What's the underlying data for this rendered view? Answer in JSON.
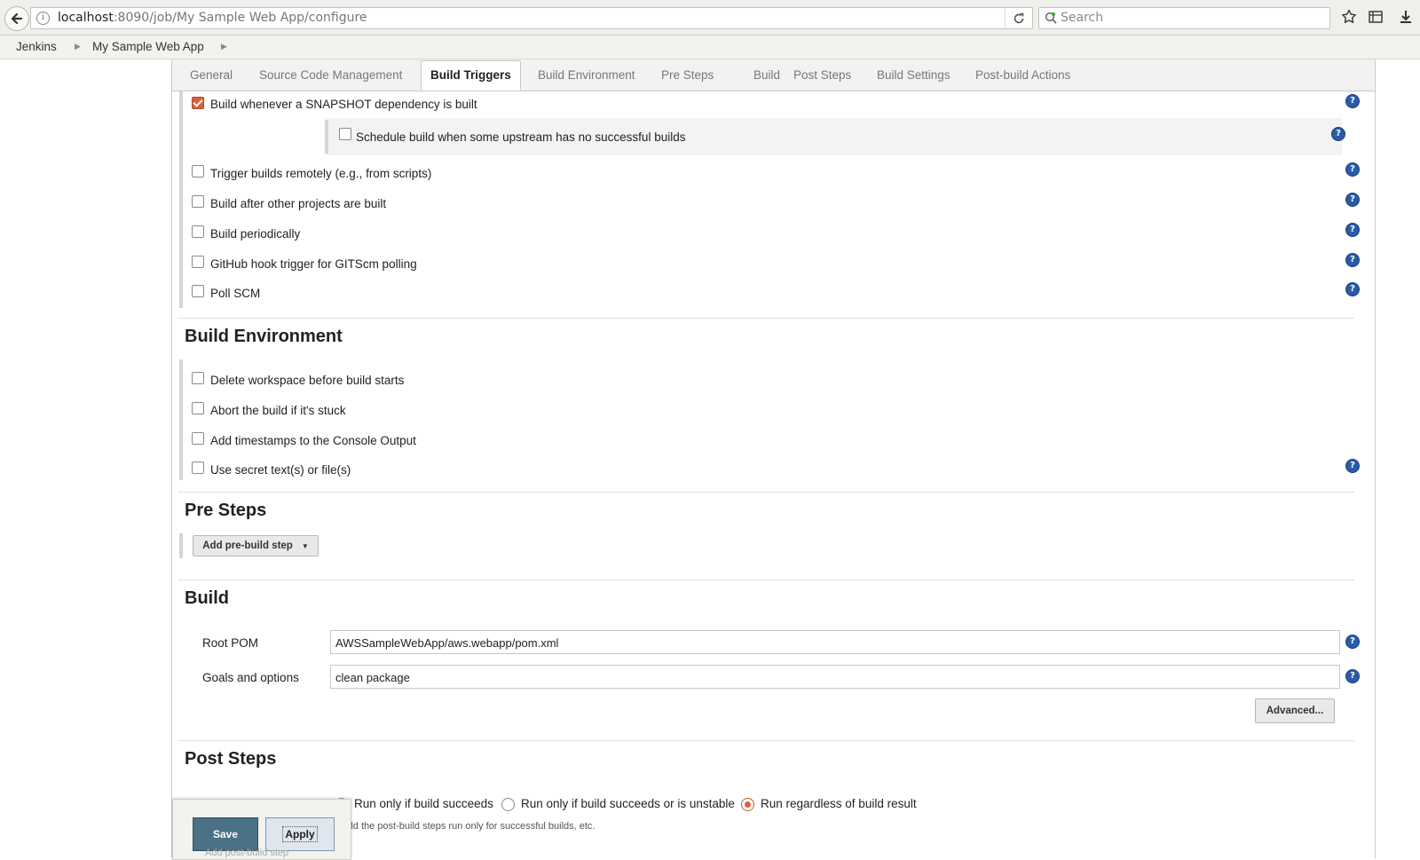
{
  "browser": {
    "url_host": "localhost",
    "url_rest": ":8090/job/My Sample Web App/configure",
    "search_placeholder": "Search"
  },
  "breadcrumb": [
    "Jenkins",
    "My Sample Web App"
  ],
  "tabs": [
    "General",
    "Source Code Management",
    "Build Triggers",
    "Build Environment",
    "Pre Steps",
    "Build",
    "Post Steps",
    "Build Settings",
    "Post-build Actions"
  ],
  "active_tab": "Build Triggers",
  "build_triggers": {
    "snapshot": {
      "label": "Build whenever a SNAPSHOT dependency is built",
      "checked": true
    },
    "upstream": {
      "label": "Schedule build when some upstream has no successful builds",
      "checked": false
    },
    "remote": {
      "label": "Trigger builds remotely (e.g., from scripts)",
      "checked": false
    },
    "after_other": {
      "label": "Build after other projects are built",
      "checked": false
    },
    "periodically": {
      "label": "Build periodically",
      "checked": false
    },
    "github_hook": {
      "label": "GitHub hook trigger for GITScm polling",
      "checked": false
    },
    "poll_scm": {
      "label": "Poll SCM",
      "checked": false
    }
  },
  "build_environment": {
    "title": "Build Environment",
    "delete_workspace": "Delete workspace before build starts",
    "abort_stuck": "Abort the build if it's stuck",
    "timestamps": "Add timestamps to the Console Output",
    "secret": "Use secret text(s) or file(s)"
  },
  "pre_steps": {
    "title": "Pre Steps",
    "add_button": "Add pre-build step"
  },
  "build": {
    "title": "Build",
    "root_pom_label": "Root POM",
    "root_pom_value": "AWSSampleWebApp/aws.webapp/pom.xml",
    "goals_label": "Goals and options",
    "goals_value": "clean package",
    "advanced_button": "Advanced..."
  },
  "post_steps": {
    "title": "Post Steps",
    "opt_succeeds": "Run only if build succeeds",
    "opt_unstable": "Run only if build succeeds or is unstable",
    "opt_regardless": "Run regardless of build result",
    "selected": "Run regardless of build result",
    "hint": "hould the post-build steps run only for successful builds, etc.",
    "add_button": "Add post-build step"
  },
  "actions": {
    "save": "Save",
    "apply": "Apply"
  },
  "colors": {
    "accent": "#d9603b",
    "help": "#2a5aa8",
    "save": "#4a7186"
  }
}
